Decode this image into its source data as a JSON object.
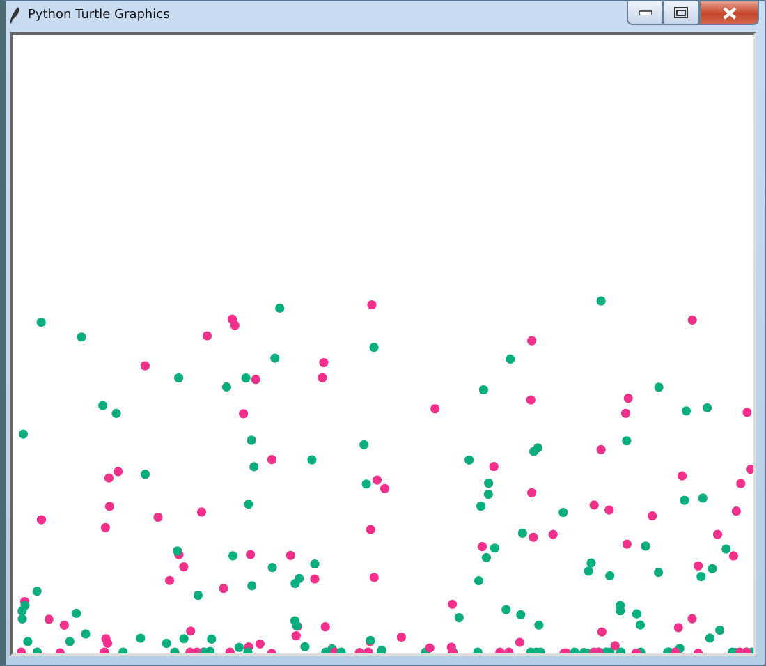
{
  "window": {
    "title": "Python Turtle Graphics",
    "controls": [
      {
        "kind": "minimize"
      },
      {
        "kind": "maximize"
      },
      {
        "kind": "close"
      }
    ]
  }
}
